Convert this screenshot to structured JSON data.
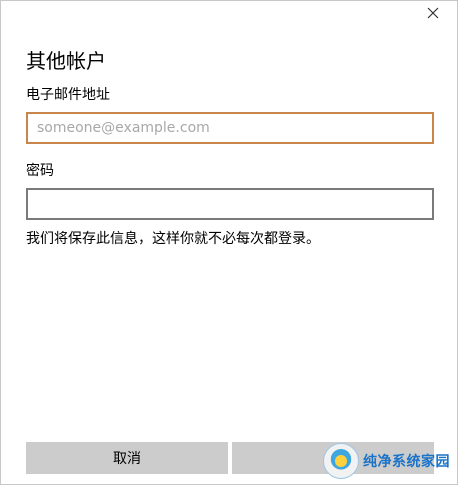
{
  "dialog": {
    "title": "其他帐户",
    "email_label": "电子邮件地址",
    "email_placeholder": "someone@example.com",
    "email_value": "",
    "password_label": "密码",
    "password_value": "",
    "note": "我们将保存此信息，这样你就不必每次都登录。",
    "cancel_label": "取消",
    "login_label": ""
  },
  "watermark": {
    "text": "纯净系统家园"
  },
  "icons": {
    "close": "close-icon",
    "watermark_logo": "watermark-logo-icon"
  },
  "colors": {
    "focus_border": "#c8864a",
    "input_border": "#7a7a7a",
    "button_bg": "#cccccc",
    "placeholder": "#a8a8a8",
    "watermark_text": "#1a73c8"
  }
}
